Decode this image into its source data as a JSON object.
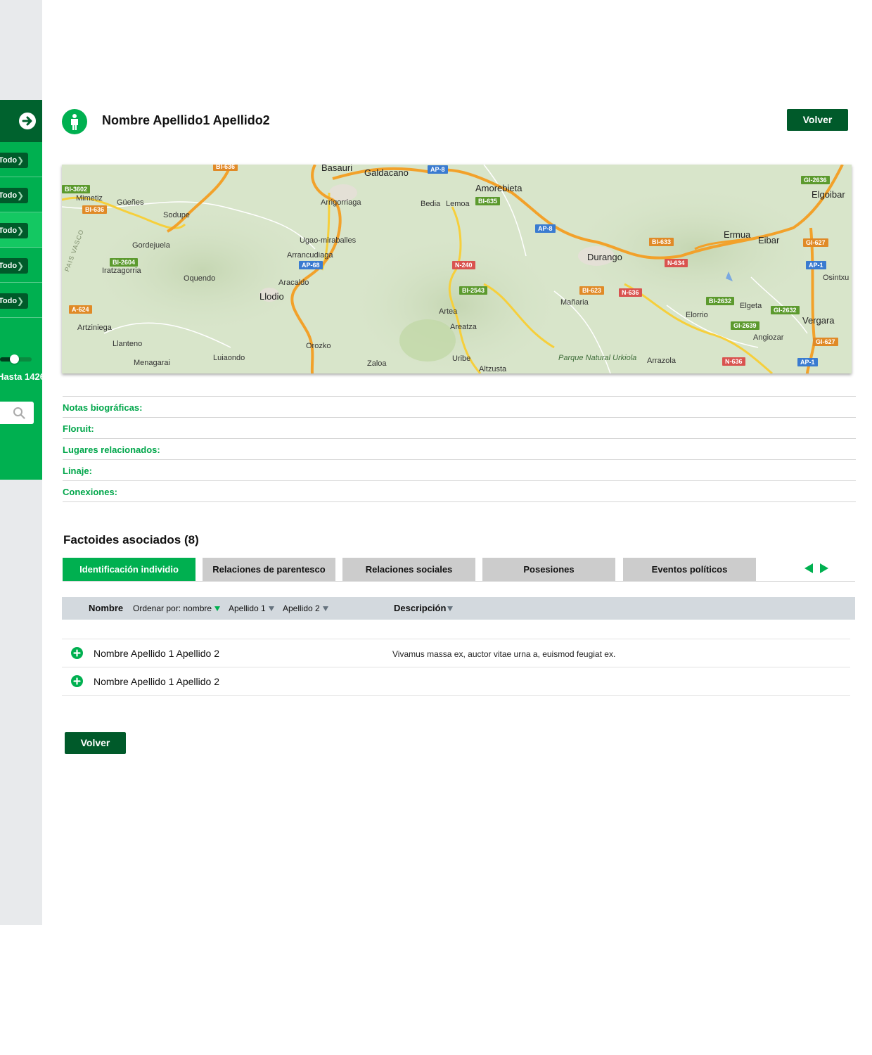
{
  "sidebar": {
    "items": [
      {
        "label": "Todo"
      },
      {
        "label": "Todo"
      },
      {
        "label": "Todo"
      },
      {
        "label": "Todo"
      },
      {
        "label": "Todo"
      }
    ],
    "slider_label": "Hasta 1426",
    "slider_level": 0.45
  },
  "header": {
    "title": "Nombre Apellido1 Apellido2",
    "back_label": "Volver"
  },
  "map": {
    "places": [
      "Basauri",
      "Galdacano",
      "Amorebieta",
      "Elgoibar",
      "Mimetiz",
      "Güeñes",
      "Sodupe",
      "Arrigorriaga",
      "Bedia",
      "Lemoa",
      "Gordejuela",
      "Ugao-miraballes",
      "Arrancudiaga",
      "Ermua",
      "Eibar",
      "Iratzagorria",
      "Durango",
      "Osintxu",
      "Oquendo",
      "Aracaldo",
      "Llodio",
      "Mañaria",
      "Elgeta",
      "Artea",
      "Elorrio",
      "Artziniega",
      "Areatza",
      "Vergara",
      "Angiozar",
      "Llanteno",
      "Orozko",
      "Menagarai",
      "Luiaondo",
      "Zaloa",
      "Uribe",
      "Altzusta",
      "Arrazola"
    ],
    "park": "Parque Natural Urkiola",
    "roads": [
      "BI-636",
      "AP-8",
      "GI-2636",
      "BI-3602",
      "BI-636",
      "BI-635",
      "AP-8",
      "BI-633",
      "GI-627",
      "BI-2604",
      "AP-68",
      "N-240",
      "N-634",
      "AP-1",
      "A-624",
      "BI-2543",
      "BI-623",
      "N-636",
      "BI-2632",
      "GI-2632",
      "GI-2639",
      "GI-627",
      "N-636",
      "AP-1"
    ],
    "region_text": "PAIS VASCO"
  },
  "info": {
    "notas": "Notas biográficas:",
    "floruit": "Floruit:",
    "lugares": "Lugares relacionados:",
    "linaje": "Linaje:",
    "conexiones": "Conexiones:"
  },
  "factoides": {
    "title": "Factoides asociados (8)",
    "tabs": [
      {
        "label": "Identificación individio"
      },
      {
        "label": "Relaciones de parentesco"
      },
      {
        "label": "Relaciones sociales"
      },
      {
        "label": "Posesiones"
      },
      {
        "label": "Eventos políticos"
      }
    ],
    "columns": {
      "nombre": "Nombre",
      "ordenar": "Ordenar por: nombre",
      "apellido1": "Apellido 1",
      "apellido2": "Apellido 2",
      "descripcion": "Descripción"
    },
    "rows": [
      {
        "name": "Nombre Apellido 1 Apellido 2",
        "description": "Vivamus massa ex, auctor vitae urna a, euismod feugiat ex."
      },
      {
        "name": "Nombre Apellido 1 Apellido 2",
        "description": ""
      }
    ]
  },
  "footer": {
    "back_label": "Volver"
  },
  "colors": {
    "primary_green": "#00b050",
    "dark_green": "#005a2a",
    "tab_gray": "#cccccc",
    "table_header": "#d3d9de"
  }
}
